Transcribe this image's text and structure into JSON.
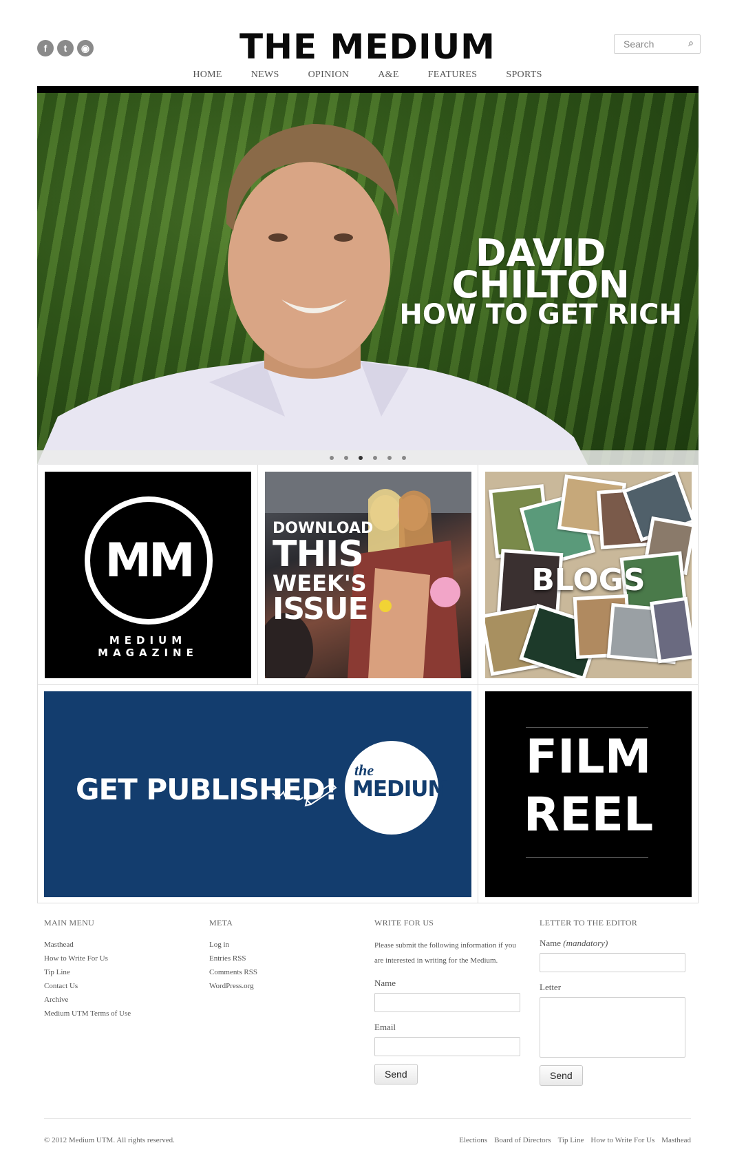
{
  "header": {
    "logo": "THE MEDIUM",
    "search_placeholder": "Search",
    "social": [
      {
        "icon": "facebook-icon",
        "glyph": "f"
      },
      {
        "icon": "twitter-icon",
        "glyph": "t"
      },
      {
        "icon": "rss-icon",
        "glyph": "◉"
      }
    ]
  },
  "nav": [
    "HOME",
    "NEWS",
    "OPINION",
    "A&E",
    "FEATURES",
    "SPORTS"
  ],
  "hero": {
    "title_line1": "DAVID",
    "title_line2": "CHILTON",
    "title_line3": "HOW TO GET RICH",
    "slides": 6,
    "active_slide": 3
  },
  "tiles": {
    "magazine": {
      "logo": "MM",
      "caption1": "MEDIUM",
      "caption2": "MAGAZINE"
    },
    "issue": {
      "line1": "DOWNLOAD",
      "line2": "THIS",
      "line3": "WEEK'S",
      "line4": "ISSUE"
    },
    "blogs": {
      "label": "BLOGS"
    },
    "publish": {
      "label": "GET PUBLISHED!",
      "logo_the": "the",
      "logo_medium": "MEDIUM"
    },
    "film": {
      "line1": "FILM",
      "line2": "REEL"
    }
  },
  "footer": {
    "main_menu": {
      "heading": "MAIN MENU",
      "items": [
        "Masthead",
        "How to Write For Us",
        "Tip Line",
        "Contact Us",
        "Archive",
        "Medium UTM Terms of Use"
      ]
    },
    "meta": {
      "heading": "META",
      "items": [
        "Log in",
        "Entries RSS",
        "Comments RSS",
        "WordPress.org"
      ]
    },
    "write_for_us": {
      "heading": "WRITE FOR US",
      "intro": "Please submit the following information if you are interested in writing for the Medium.",
      "name_label": "Name",
      "email_label": "Email",
      "send_label": "Send"
    },
    "letter": {
      "heading": "LETTER TO THE EDITOR",
      "name_label": "Name",
      "name_note": "(mandatory)",
      "letter_label": "Letter",
      "send_label": "Send"
    },
    "copyright": "© 2012 Medium UTM. All rights reserved.",
    "links": [
      "Elections",
      "Board of Directors",
      "Tip Line",
      "How to Write For Us",
      "Masthead"
    ]
  },
  "colors": {
    "publish_blue": "#133d6e",
    "hero_green": "#375e1d"
  }
}
